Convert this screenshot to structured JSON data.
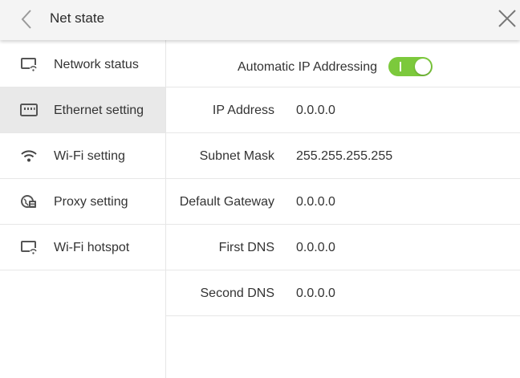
{
  "header": {
    "title": "Net state",
    "back_icon": "chevron-left-icon",
    "close_icon": "close-icon"
  },
  "sidebar": {
    "items": [
      {
        "label": "Network status",
        "icon": "monitor-wifi-icon",
        "active": false
      },
      {
        "label": "Ethernet setting",
        "icon": "ethernet-port-icon",
        "active": true
      },
      {
        "label": "Wi-Fi setting",
        "icon": "wifi-icon",
        "active": false
      },
      {
        "label": "Proxy setting",
        "icon": "proxy-globe-icon",
        "active": false
      },
      {
        "label": "Wi-Fi hotspot",
        "icon": "monitor-wifi-icon",
        "active": false
      }
    ]
  },
  "ethernet": {
    "auto_ip_label": "Automatic IP Addressing",
    "auto_ip_enabled": true,
    "toggle_color": "#7cc93c",
    "fields": [
      {
        "label": "IP Address",
        "value": "0.0.0.0"
      },
      {
        "label": "Subnet Mask",
        "value": "255.255.255.255"
      },
      {
        "label": "Default Gateway",
        "value": "0.0.0.0"
      },
      {
        "label": "First DNS",
        "value": "0.0.0.0"
      },
      {
        "label": "Second DNS",
        "value": "0.0.0.0"
      }
    ]
  }
}
